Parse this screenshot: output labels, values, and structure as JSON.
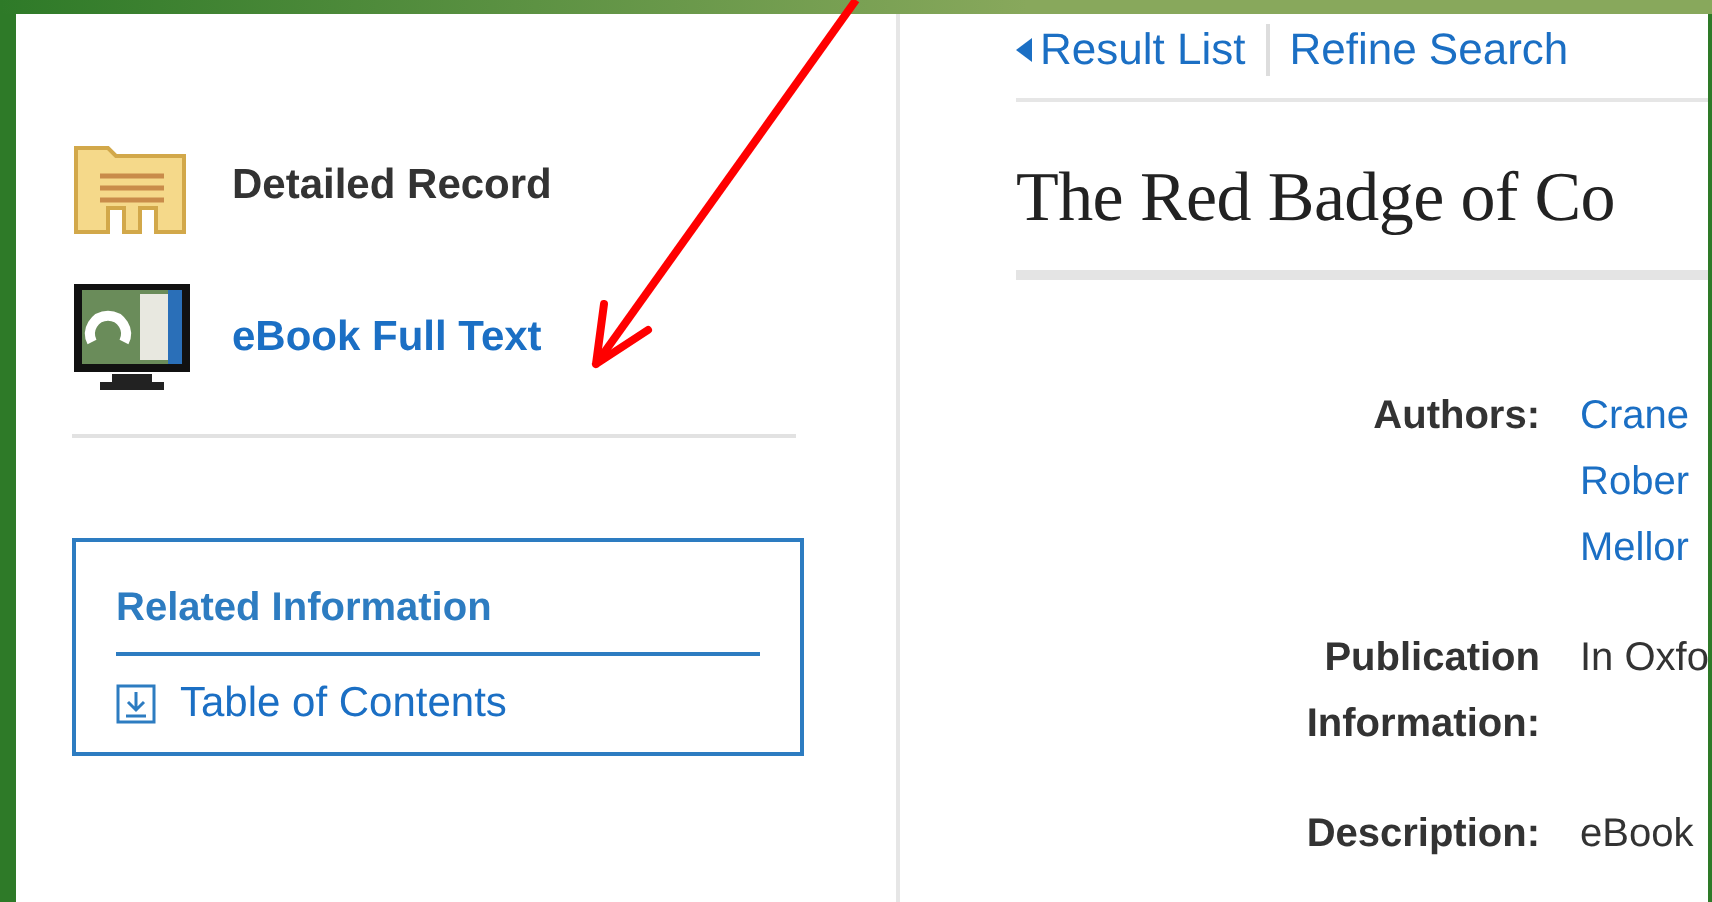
{
  "sidebar": {
    "formats": [
      {
        "kind": "record",
        "label": "Detailed Record",
        "link": false
      },
      {
        "kind": "ebook",
        "label": "eBook Full Text",
        "link": true
      }
    ],
    "related": {
      "title": "Related Information",
      "items": [
        {
          "label": "Table of Contents"
        }
      ]
    }
  },
  "nav": {
    "links": [
      {
        "label": "Result List",
        "back": true
      },
      {
        "label": "Refine Search",
        "back": false
      }
    ]
  },
  "record": {
    "title": "The Red Badge of Co",
    "fields": [
      {
        "label": "Authors:",
        "values": [
          "Crane",
          "Rober",
          "Mellor"
        ],
        "link": true
      },
      {
        "label": "Publication Information:",
        "values": [
          "In Oxfo"
        ],
        "link": false
      },
      {
        "label": "Description:",
        "values": [
          "eBook"
        ],
        "link": false
      }
    ]
  },
  "annotation": {
    "kind": "arrow",
    "color": "#ff0000"
  }
}
